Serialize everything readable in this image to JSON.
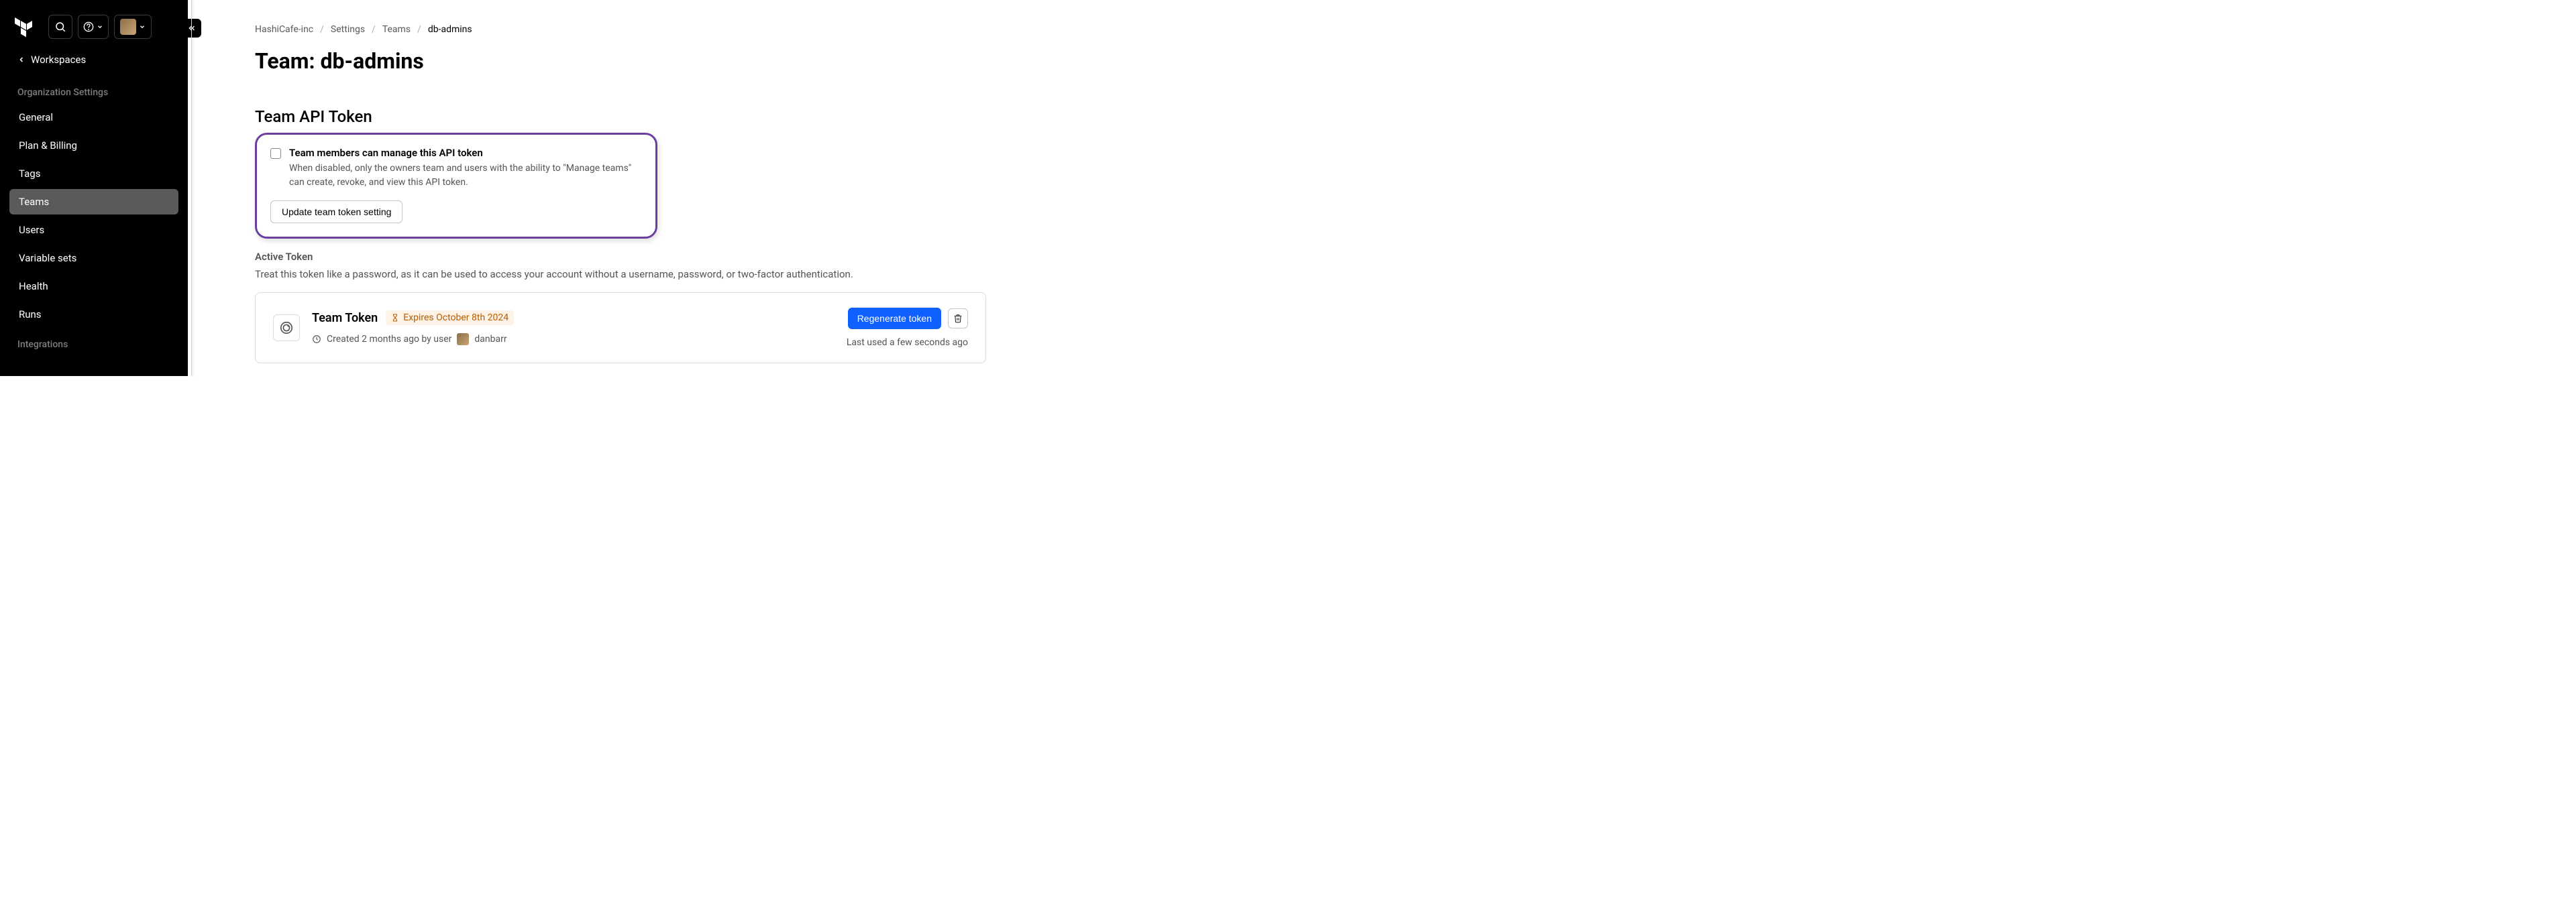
{
  "sidebar": {
    "workspaces_label": "Workspaces",
    "sections": {
      "org_settings": {
        "title": "Organization Settings",
        "items": [
          {
            "label": "General"
          },
          {
            "label": "Plan & Billing"
          },
          {
            "label": "Tags"
          },
          {
            "label": "Teams",
            "active": true
          },
          {
            "label": "Users"
          },
          {
            "label": "Variable sets"
          },
          {
            "label": "Health"
          },
          {
            "label": "Runs"
          }
        ]
      },
      "integrations": {
        "title": "Integrations"
      }
    }
  },
  "breadcrumbs": {
    "items": [
      "HashiCafe-inc",
      "Settings",
      "Teams"
    ],
    "current": "db-admins"
  },
  "page": {
    "title": "Team: db-admins"
  },
  "token_section": {
    "title": "Team API Token",
    "checkbox_label": "Team members can manage this API token",
    "checkbox_desc": "When disabled, only the owners team and users with the ability to \"Manage teams\" can create, revoke, and view this API token.",
    "update_button": "Update team token setting",
    "active_heading": "Active Token",
    "active_desc": "Treat this token like a password, as it can be used to access your account without a username, password, or two-factor authentication.",
    "card": {
      "title": "Team Token",
      "expiry": "Expires October 8th 2024",
      "created_prefix": "Created 2 months ago by user",
      "created_user": "danbarr",
      "regenerate": "Regenerate token",
      "last_used": "Last used a few seconds ago"
    }
  }
}
